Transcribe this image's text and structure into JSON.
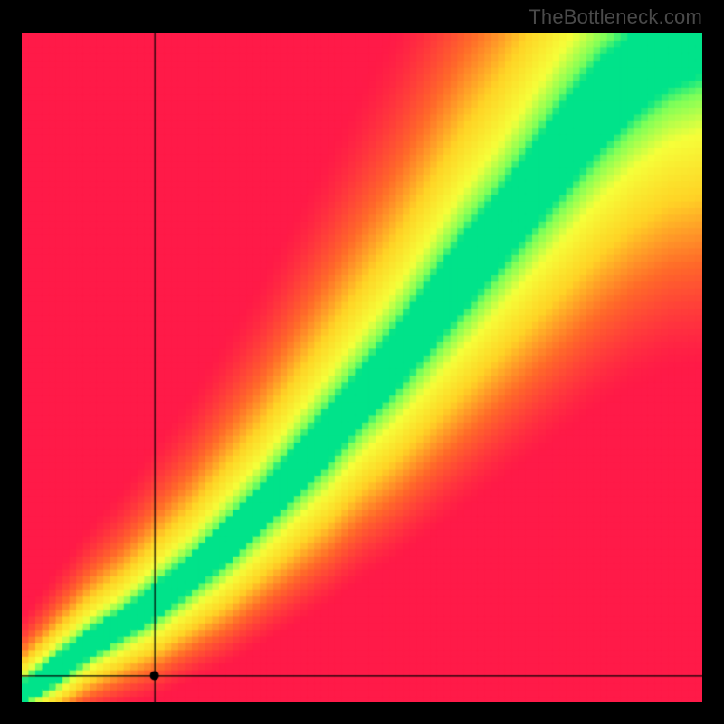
{
  "watermark": "TheBottleneck.com",
  "chart_data": {
    "type": "heatmap",
    "title": "",
    "xlabel": "",
    "ylabel": "",
    "xlim": [
      0,
      1
    ],
    "ylim": [
      0,
      1
    ],
    "colormap": {
      "stops": [
        {
          "t": 0.0,
          "color": "#ff1a48"
        },
        {
          "t": 0.25,
          "color": "#ff6a2a"
        },
        {
          "t": 0.5,
          "color": "#ffd426"
        },
        {
          "t": 0.75,
          "color": "#f6ff3a"
        },
        {
          "t": 0.92,
          "color": "#7cff5a"
        },
        {
          "t": 1.0,
          "color": "#00e38a"
        }
      ]
    },
    "crosshair": {
      "x": 0.195,
      "y": 0.04
    },
    "optimal_band": {
      "description": "green band tracing y ≈ f(x) through the field",
      "samples": [
        {
          "x": 0.0,
          "y_low": 0.0,
          "y_high": 0.03
        },
        {
          "x": 0.05,
          "y_low": 0.03,
          "y_high": 0.07
        },
        {
          "x": 0.1,
          "y_low": 0.07,
          "y_high": 0.11
        },
        {
          "x": 0.15,
          "y_low": 0.1,
          "y_high": 0.14
        },
        {
          "x": 0.2,
          "y_low": 0.13,
          "y_high": 0.18
        },
        {
          "x": 0.25,
          "y_low": 0.17,
          "y_high": 0.22
        },
        {
          "x": 0.3,
          "y_low": 0.21,
          "y_high": 0.27
        },
        {
          "x": 0.35,
          "y_low": 0.26,
          "y_high": 0.32
        },
        {
          "x": 0.4,
          "y_low": 0.31,
          "y_high": 0.38
        },
        {
          "x": 0.45,
          "y_low": 0.36,
          "y_high": 0.44
        },
        {
          "x": 0.5,
          "y_low": 0.42,
          "y_high": 0.5
        },
        {
          "x": 0.55,
          "y_low": 0.47,
          "y_high": 0.56
        },
        {
          "x": 0.6,
          "y_low": 0.53,
          "y_high": 0.63
        },
        {
          "x": 0.65,
          "y_low": 0.59,
          "y_high": 0.7
        },
        {
          "x": 0.7,
          "y_low": 0.65,
          "y_high": 0.76
        },
        {
          "x": 0.75,
          "y_low": 0.71,
          "y_high": 0.83
        },
        {
          "x": 0.8,
          "y_low": 0.77,
          "y_high": 0.9
        },
        {
          "x": 0.85,
          "y_low": 0.83,
          "y_high": 0.96
        },
        {
          "x": 0.9,
          "y_low": 0.88,
          "y_high": 1.0
        },
        {
          "x": 0.95,
          "y_low": 0.92,
          "y_high": 1.0
        },
        {
          "x": 1.0,
          "y_low": 0.94,
          "y_high": 1.0
        }
      ]
    },
    "grid_resolution": 100
  }
}
